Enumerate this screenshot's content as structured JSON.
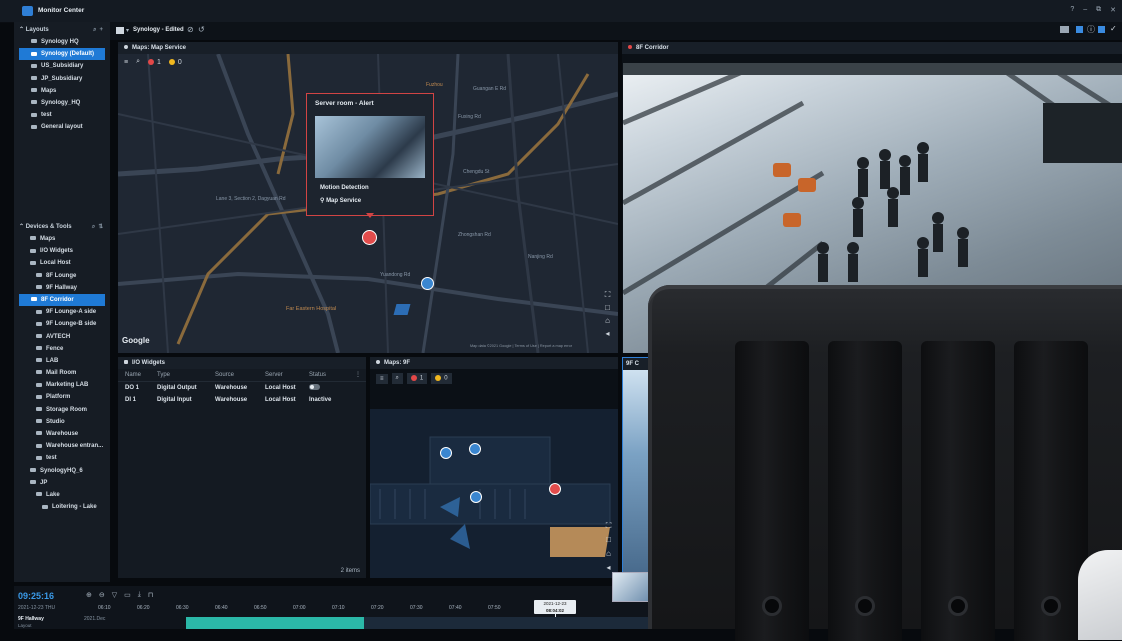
{
  "app": {
    "title": "Monitor Center",
    "window_buttons": [
      "?",
      "–",
      "⧉",
      "✕"
    ]
  },
  "sidebar": {
    "layouts_header": "Layouts",
    "layouts": [
      "Synology HQ",
      "Synology (Default)",
      "US_Subsidiary",
      "JP_Subsidiary",
      "Maps",
      "Synology_HQ",
      "test",
      "General layout"
    ],
    "selected_layout": "Synology (Default)",
    "devices_header": "Devices & Tools",
    "devices": [
      {
        "label": "Maps",
        "indent": 1
      },
      {
        "label": "I/O Widgets",
        "indent": 1
      },
      {
        "label": "Local Host",
        "indent": 1
      },
      {
        "label": "8F Lounge",
        "indent": 2
      },
      {
        "label": "9F Hallway",
        "indent": 2
      },
      {
        "label": "8F Corridor",
        "indent": 2,
        "selected": true
      },
      {
        "label": "9F Lounge-A side",
        "indent": 2
      },
      {
        "label": "9F Lounge-B side",
        "indent": 2
      },
      {
        "label": "AVTECH",
        "indent": 2
      },
      {
        "label": "Fence",
        "indent": 2
      },
      {
        "label": "LAB",
        "indent": 2
      },
      {
        "label": "Mail Room",
        "indent": 2
      },
      {
        "label": "Marketing LAB",
        "indent": 2
      },
      {
        "label": "Platform",
        "indent": 2
      },
      {
        "label": "Storage Room",
        "indent": 2
      },
      {
        "label": "Studio",
        "indent": 2
      },
      {
        "label": "Warehouse",
        "indent": 2
      },
      {
        "label": "Warehouse entran...",
        "indent": 2
      },
      {
        "label": "test",
        "indent": 2
      },
      {
        "label": "SynologyHQ_6",
        "indent": 1
      },
      {
        "label": "JP",
        "indent": 1
      },
      {
        "label": "Lake",
        "indent": 2
      },
      {
        "label": "Loitering - Lake",
        "indent": 3
      }
    ]
  },
  "toolbar": {
    "layout_name": "Synology - Edited"
  },
  "map_pane": {
    "title": "Maps: Map Service",
    "red_count": "1",
    "yellow_count": "0",
    "google": "Google",
    "attribution": "Map data ©2021 Google | Terms of Use | Report a map error",
    "street_labels": [
      "Fuzhou",
      "Fuxing Rd",
      "Guangan E Rd",
      "Chengdu St",
      "Nanjing Rd",
      "Zhongshan Rd",
      "Lane 3, Section 2, Dagyuan Rd",
      "Yuandong Rd",
      "Far Eastern Hospital"
    ],
    "popup": {
      "title": "Server room - Alert",
      "event": "Motion Detection",
      "source": "Map Service"
    }
  },
  "corridor_pane": {
    "title": "8F Corridor"
  },
  "io_pane": {
    "title": "I/O Widgets",
    "columns": [
      "Name",
      "Type",
      "Source",
      "Server",
      "Status"
    ],
    "rows": [
      {
        "name": "DO 1",
        "type": "Digital Output",
        "source": "Warehouse",
        "server": "Local Host",
        "status": ""
      },
      {
        "name": "DI 1",
        "type": "Digital Input",
        "source": "Warehouse",
        "server": "Local Host",
        "status": "Inactive"
      }
    ],
    "footer": "2 items"
  },
  "floor_pane": {
    "title": "Maps: 9F",
    "red_count": "1",
    "yellow_count": "0"
  },
  "small_pane": {
    "title": "9F C"
  },
  "timeline": {
    "clock": "09:25:16",
    "date": "2021-12-23 THU",
    "ticks": [
      "06:10",
      "06:20",
      "06:30",
      "06:40",
      "06:50",
      "07:00",
      "07:10",
      "07:20",
      "07:30",
      "07:40",
      "07:50"
    ],
    "marker_date": "2021-12-23",
    "marker_time": "08:04:02",
    "track_label": "9F Hallway",
    "track_sub": "Layout",
    "track_date": "2021.Dec"
  }
}
